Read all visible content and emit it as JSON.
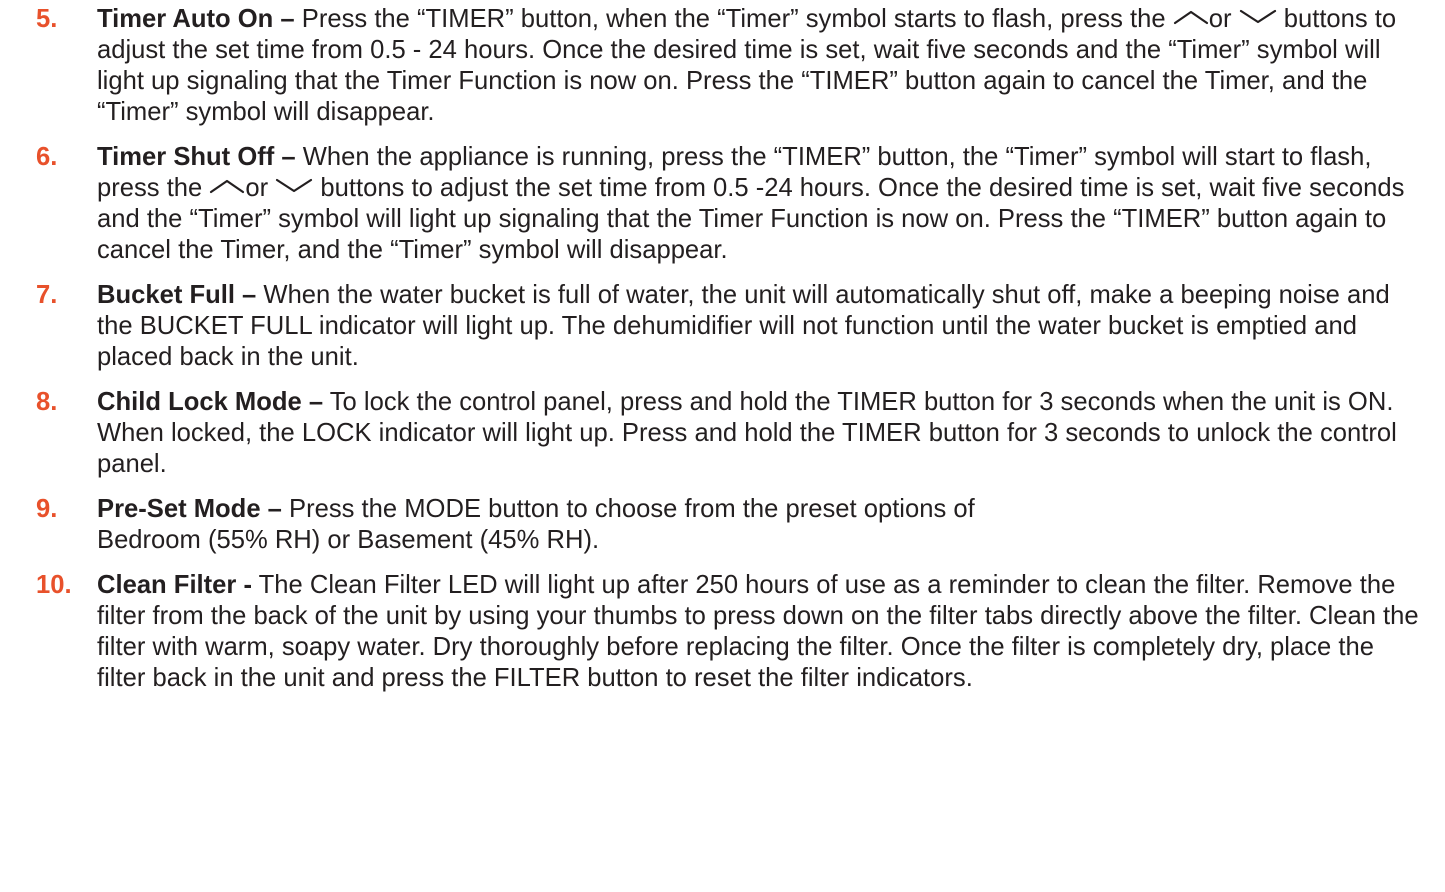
{
  "accent_color": "#e8512b",
  "items": [
    {
      "number": "5.",
      "title": "Timer Auto On –",
      "text_before": " Press the “TIMER” button, when the “Timer” symbol starts to flash, press the ",
      "or": "or",
      "text_after": " buttons to adjust the set time from 0.5 - 24 hours. Once the desired time is set, wait five seconds and the “Timer” symbol will light up signaling that the Timer Function is now on. Press the “TIMER” button again to cancel the Timer, and the “Timer” symbol will disappear."
    },
    {
      "number": "6.",
      "title": "Timer Shut Off –",
      "text_before": " When the appliance is running, press the “TIMER” button, the “Timer” symbol will start to flash, press the ",
      "or": "or",
      "text_after": " buttons to adjust the set time from 0.5 -24 hours. Once the desired time is set, wait five seconds and the “Timer” symbol will light up signaling that the Timer Function is now on. Press the “TIMER” button again to cancel the Timer, and the “Timer” symbol will disappear."
    },
    {
      "number": "7.",
      "title": "Bucket Full –",
      "text": " When the water bucket is full of water, the unit will automatically shut off, make a beeping noise and the BUCKET FULL indicator will light up.  The dehumidifier will not function until the water bucket is emptied and placed back in the unit."
    },
    {
      "number": "8.",
      "title": "Child Lock Mode –",
      "text": " To lock the control panel, press and hold the TIMER button for 3 seconds when the unit is ON.  When locked, the LOCK indicator will light up.  Press and hold the TIMER button for 3 seconds to unlock the control panel."
    },
    {
      "number": "9.",
      "title": "Pre-Set Mode –",
      "text_line1": " Press the MODE button to choose from the preset options of",
      "text_line2": "Bedroom (55% RH) or Basement (45% RH)."
    },
    {
      "number": "10.",
      "title": "Clean Filter -",
      "text": " The Clean Filter LED will light up after 250 hours of use as a reminder to clean the filter. Remove the filter from the back of the unit by using your thumbs to press down on the filter tabs directly above the filter. Clean the filter with warm, soapy water. Dry thoroughly before replacing the filter. Once the filter is completely dry, place the filter back in the unit and press the FILTER button to reset the filter indicators."
    }
  ],
  "icons": {
    "up": "chevron-up-icon",
    "down": "chevron-down-icon"
  }
}
